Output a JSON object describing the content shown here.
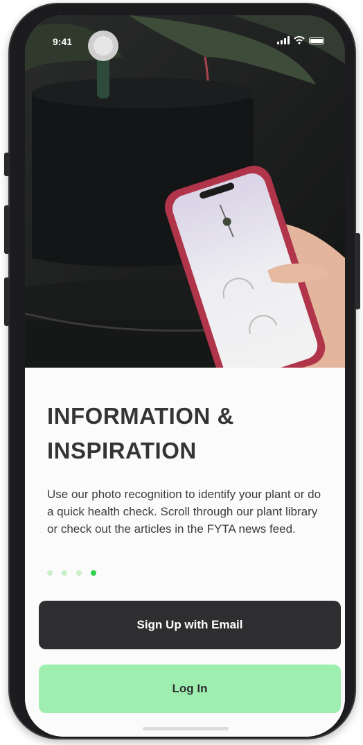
{
  "status_bar": {
    "time": "9:41",
    "icons": [
      "signal-icon",
      "wifi-icon",
      "battery-icon"
    ]
  },
  "hero_image": {
    "subject": "hand holding a phone in front of a potted plant with a sensor"
  },
  "onboarding": {
    "title": "INFORMATION & INSPIRATION",
    "description": "Use our photo recognition to identify your plant or do a quick health check. Scroll through our plant library or check out the articles in the FYTA news feed.",
    "page_indicator": {
      "total": 4,
      "current": 4
    }
  },
  "actions": {
    "signup_label": "Sign Up with Email",
    "login_label": "Log In"
  },
  "colors": {
    "primary_dark": "#2e2e30",
    "accent_green": "#9eeeb0",
    "dot_active": "#2fd24a",
    "dot_inactive": "#c9eec9",
    "text_dark": "#343434"
  }
}
